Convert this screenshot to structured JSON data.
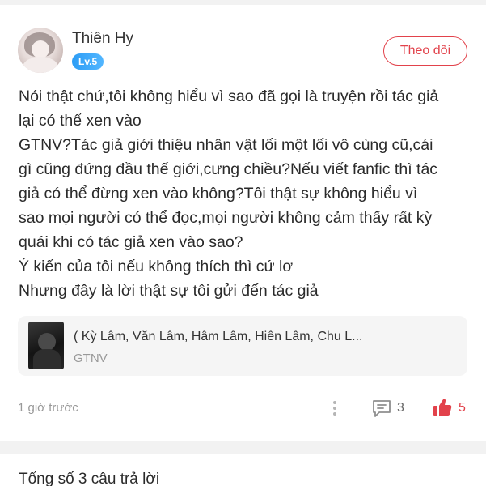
{
  "user": {
    "name": "Thiên Hy",
    "level": "Lv.5",
    "follow_label": "Theo dõi"
  },
  "post": {
    "lines": [
      "Nói thật chứ,tôi không hiểu vì sao đã gọi là truyện rồi tác giả",
      "lại có thể xen vào",
      "GTNV?Tác giả giới thiệu nhân vật lối một lối vô cùng cũ,cái",
      "gì cũng đứng đầu thế giới,cưng chiều?Nếu viết fanfic thì tác",
      "giả có thể đừng xen vào không?Tôi thật sự không hiểu vì",
      "sao mọi người có thể đọc,mọi người không cảm thấy rất kỳ",
      "quái khi có tác giả xen vào sao?",
      "Ý kiến của tôi nếu không thích thì cứ lơ",
      "Nhưng đây là lời thật sự tôi gửi đến tác giả"
    ]
  },
  "book": {
    "title": "( Kỳ Lâm, Văn Lâm, Hâm Lâm, Hiên Lâm, Chu L...",
    "tag": "GTNV"
  },
  "footer": {
    "timestamp": "1 giờ trước",
    "comment_count": "3",
    "like_count": "5"
  },
  "replies": {
    "title": "Tổng số 3 câu trả lời"
  },
  "colors": {
    "accent": "#e2424b",
    "badge": "#2d9df5"
  },
  "icons": {
    "more": "more-vertical-icon",
    "comment": "comment-icon",
    "like": "thumbs-up-icon"
  }
}
